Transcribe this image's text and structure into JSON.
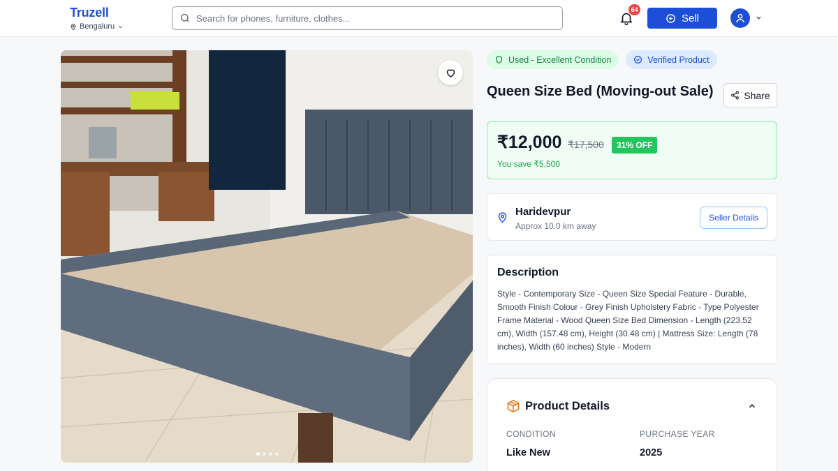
{
  "header": {
    "logo": "Truzell",
    "location": "Bengaluru",
    "search_placeholder": "Search for phones, furniture, clothes...",
    "notification_count": "64",
    "sell_label": "Sell"
  },
  "gallery": {
    "image_count": 4,
    "active_index": 0
  },
  "badges": {
    "condition": "Used - Excellent Condition",
    "verified": "Verified Product"
  },
  "product": {
    "title": "Queen Size Bed (Moving-out Sale)",
    "share_label": "Share",
    "price": "₹12,000",
    "original_price": "₹17,500",
    "discount": "31% OFF",
    "savings": "You save ₹5,500"
  },
  "location_card": {
    "name": "Haridevpur",
    "distance": "Approx 10.0 km away",
    "seller_button": "Seller Details"
  },
  "description": {
    "title": "Description",
    "text": "Style - Contemporary Size - Queen Size Special Feature - Durable, Smooth Finish Colour - Grey Finish Upholstery Fabric - Type Polyester Frame Material - Wood Queen Size Bed Dimension - Length (223.52 cm), Width (157.48 cm), Height (30.48 cm) | Mattress Size: Length (78 inches), Width (60 inches) Style - Modern"
  },
  "product_details": {
    "title": "Product Details",
    "fields": [
      {
        "label": "CONDITION",
        "value": "Like New"
      },
      {
        "label": "PURCHASE YEAR",
        "value": "2025"
      }
    ]
  },
  "colors": {
    "brand": "#1d4ed8",
    "success": "#22c55e",
    "badge": "#ef4444"
  },
  "icons": [
    "pin-icon",
    "search-icon",
    "bell-icon",
    "plus-circle-icon",
    "user-icon",
    "chevron-down-icon",
    "heart-icon",
    "shield-icon",
    "check-badge-icon",
    "share-icon",
    "map-pin-icon",
    "box-icon",
    "chevron-up-icon"
  ]
}
